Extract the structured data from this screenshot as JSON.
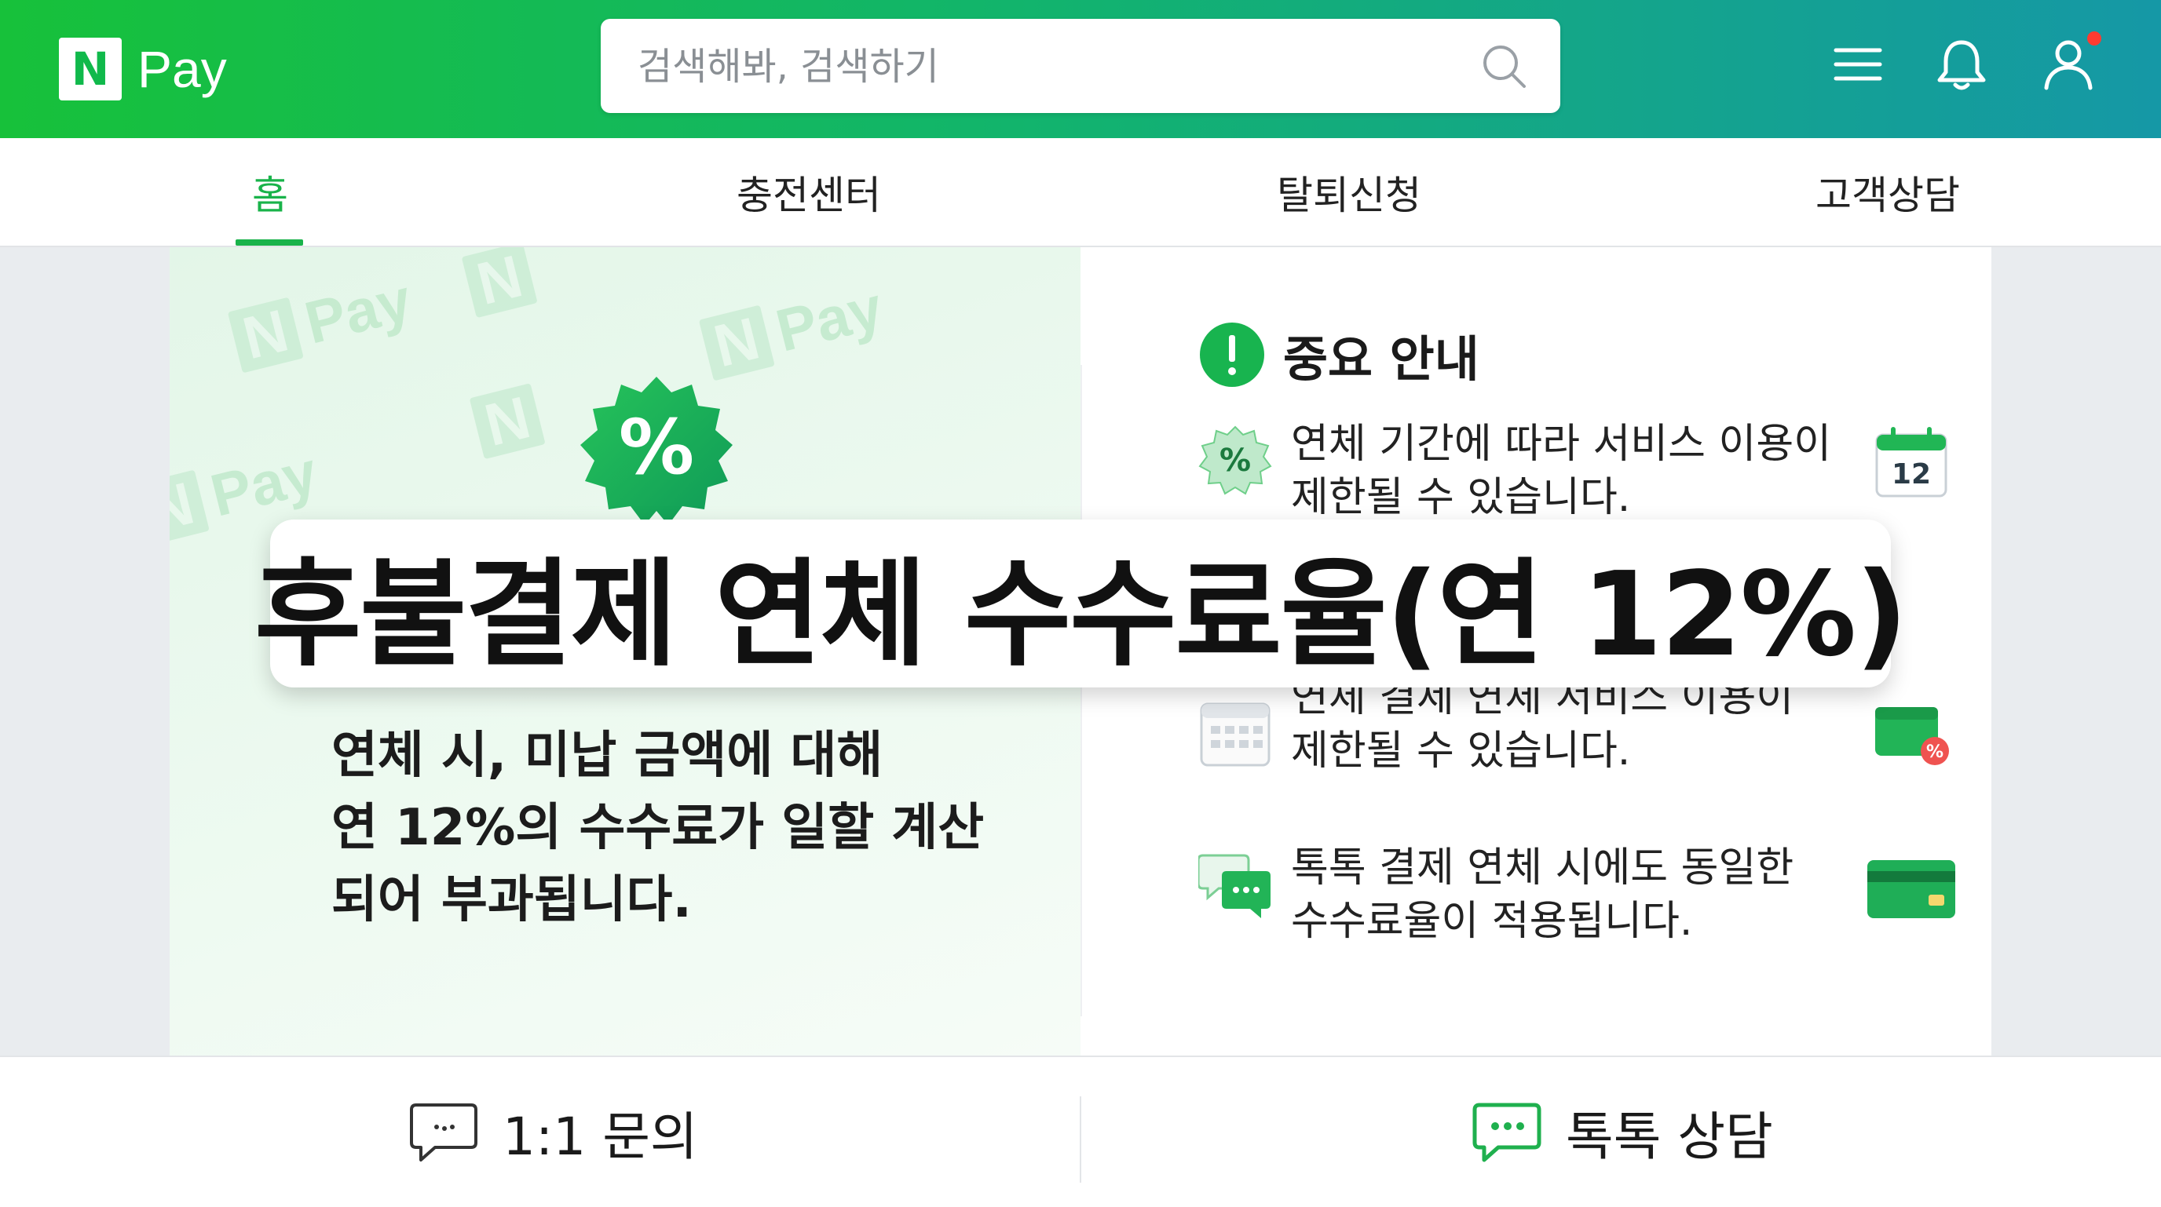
{
  "header": {
    "brand_mark": "N",
    "brand_name": "Pay",
    "search_placeholder": "검색해봐, 검색하기",
    "icons": [
      "search-icon",
      "menu-icon",
      "bell-icon",
      "user-icon"
    ]
  },
  "tabs": [
    {
      "label": "홈",
      "active": true
    },
    {
      "label": "충전센터",
      "active": false
    },
    {
      "label": "탈퇴신청",
      "active": false
    },
    {
      "label": "고객상담",
      "active": false
    }
  ],
  "left": {
    "badge_symbol": "%",
    "watermark_text": "Pay",
    "description": "연체 시, 미납 금액에 대해\n연 12%의 수수료가 일할 계산\n되어 부과됩니다."
  },
  "overlay_title": "후불결제 연체 수수료율(연 12%)",
  "notice": {
    "title": "중요 안내",
    "items": [
      {
        "text": "연체 기간에 따라 서비스 이용이\n제한될 수 있습니다.",
        "icon": "percent-badge-icon",
        "right_icon": "calendar-icon",
        "calendar_day": "12"
      },
      {
        "text": "연체 결제 연체 서비스 이용이\n제한될 수 있습니다.",
        "icon": "calendar-grid-icon",
        "right_icon": "wallet-percent-icon"
      },
      {
        "text": "톡톡 결제 연체 시에도 동일한\n수수료율이 적용됩니다.",
        "icon": "chat-bubbles-icon",
        "right_icon": "credit-card-icon"
      }
    ]
  },
  "bottom": {
    "inquiry_label": "1:1 문의",
    "talk_label": "톡톡 상담"
  },
  "colors": {
    "brand_green": "#19b34a",
    "header_gradient_start": "#17c13a",
    "header_gradient_end": "#1598a6",
    "notification_dot": "#ff3b30"
  }
}
